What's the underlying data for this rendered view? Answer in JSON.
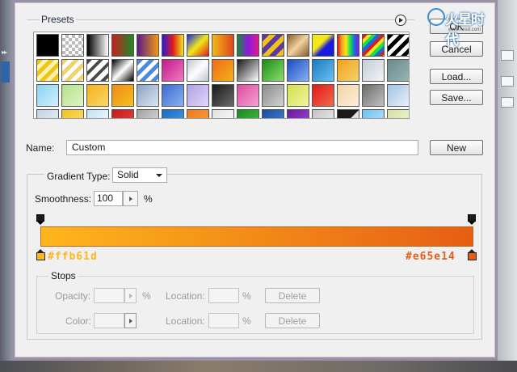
{
  "presets": {
    "label": "Presets",
    "swatches": [
      "linear-gradient(135deg,#000,#000)",
      "repeating-conic-gradient(#bbb 0% 25%, #fff 0% 50%) 0 0/8px 8px",
      "linear-gradient(90deg,#000,#fff)",
      "linear-gradient(90deg,#c81e1e,#1e8a2a)",
      "linear-gradient(90deg,#5a1a8a,#f29a12)",
      "linear-gradient(90deg,#2a1ae0,#e01a1a,#f2e81a)",
      "linear-gradient(135deg,#1a2ae0,#f2e81a,#e01a1a)",
      "linear-gradient(90deg,#f2b81a,#e0461a)",
      "linear-gradient(90deg,#1a8a3a,#8a1ae0,#e01a8a)",
      "repeating-linear-gradient(135deg,#5a3aa0 0 6px,#f2c21a 6px 12px)",
      "linear-gradient(135deg,#8a5a2a,#f2d2a0,#8a5a2a)",
      "linear-gradient(135deg,#f2e81a 40%,#1a1ae0 60%)",
      "linear-gradient(90deg,#e01a1a,#f2a21a,#f2e81a,#1ae04a,#1a6ae0,#8a1ae0)",
      "repeating-linear-gradient(135deg,#e01a1a 0 4px,#f2e81a 4px 8px,#1ae04a 8px 12px,#1a6ae0 12px 16px)",
      "repeating-linear-gradient(135deg,#000 0 5px,#fff 5px 10px)",
      "repeating-linear-gradient(135deg,#f2c21a 0 5px,#fff4b0 5px 10px)",
      "repeating-linear-gradient(135deg,#f2d26a 0 5px,#fff 5px 10px)",
      "repeating-linear-gradient(135deg,#4a4a4a 0 4px,#fff 4px 10px)",
      "linear-gradient(135deg,#000,#fff,#000)",
      "repeating-linear-gradient(135deg,#4a8ae0 0 5px,#fff 5px 10px)",
      "linear-gradient(135deg,#c21a8a,#f27ac2)",
      "linear-gradient(135deg,#c0c4cc,#ffffff,#c0c4cc)",
      "linear-gradient(135deg,#f26a1a,#f2b21a)",
      "linear-gradient(135deg,#1a1a1a,#8a8a8a,#ffffff)",
      "linear-gradient(135deg,#1a8a1a,#8ae06a)",
      "linear-gradient(135deg,#1a4ac2,#8ab2f2)",
      "linear-gradient(135deg,#1a7ac2,#6ac2f2)",
      "linear-gradient(135deg,#f2a21a,#f2d26a)",
      "linear-gradient(135deg,#c4ccd6,#f2f4f8)",
      "linear-gradient(135deg,#6a8a8a,#9ab2b2)",
      "linear-gradient(135deg,#8ad2f2,#d2f0fc)",
      "linear-gradient(135deg,#b2e08a,#e0f4c2)",
      "linear-gradient(135deg,#f2b21a,#fcd66a)",
      "linear-gradient(135deg,#f28a1a,#f2c21a)",
      "linear-gradient(135deg,#8aa2c2,#dce6f4)",
      "linear-gradient(135deg,#3a6ad2,#8ab2f2)",
      "linear-gradient(135deg,#b2a2e0,#e0d6fc)",
      "linear-gradient(135deg,#1a1a1a,#6a6a6a)",
      "linear-gradient(135deg,#e04aa2,#f2a2d2)",
      "linear-gradient(135deg,#8a8a8a,#d2d2d2)",
      "linear-gradient(135deg,#d2e04a,#f2f4a2)",
      "linear-gradient(135deg,#e01a1a,#f26a4a)",
      "linear-gradient(135deg,#f2d2a2,#fcf0dc)",
      "linear-gradient(135deg,#6a6a6a,#c2c2c2)",
      "linear-gradient(135deg,#a2c2e0,#e6f0fa)",
      "linear-gradient(135deg,#c2d2e0,#eef4fa)",
      "linear-gradient(135deg,#f2c21a,#fce28a)",
      "linear-gradient(135deg,#c2e0f2,#ffffff)",
      "linear-gradient(135deg,#c81a1a,#e04a4a)",
      "linear-gradient(135deg,#a2a2a2,#e2e2e2)",
      "linear-gradient(135deg,#1a6ac2,#4aa2e0)",
      "linear-gradient(135deg,#f27a1a,#f2a24a)",
      "linear-gradient(135deg,#e0e0e0,#ffffff)",
      "linear-gradient(135deg,#1a8a1a,#4ac24a)",
      "linear-gradient(135deg,#1a4aa2,#4a8ad2)",
      "linear-gradient(135deg,#6a1aa2,#a24ad2)",
      "linear-gradient(135deg,#c2c2c2,#f2f2f2)",
      "linear-gradient(135deg,#1a1a1a 50%,#e0e0e0 50%)",
      "linear-gradient(135deg,#6ac2f2,#c2e6fc)",
      "linear-gradient(135deg,#d2e0a2,#f4f8dc)"
    ]
  },
  "buttons": {
    "ok": "OK",
    "cancel": "Cancel",
    "load": "Load...",
    "save": "Save...",
    "new": "New"
  },
  "watermark": {
    "text": "火星时代",
    "url": "www.hxsd.com"
  },
  "name": {
    "label": "Name:",
    "value": "Custom"
  },
  "gradient": {
    "type_label": "Gradient Type:",
    "type_value": "Solid",
    "smoothness_label": "Smoothness:",
    "smoothness_value": "100",
    "smoothness_unit": "%",
    "start_color": "#ffb61d",
    "end_color": "#e65e14",
    "start_label": "#ffb61d",
    "end_label": "#e65e14"
  },
  "stops": {
    "label": "Stops",
    "opacity_label": "Opacity:",
    "opacity_unit": "%",
    "location_label": "Location:",
    "location_unit": "%",
    "color_label": "Color:",
    "delete_label": "Delete"
  }
}
